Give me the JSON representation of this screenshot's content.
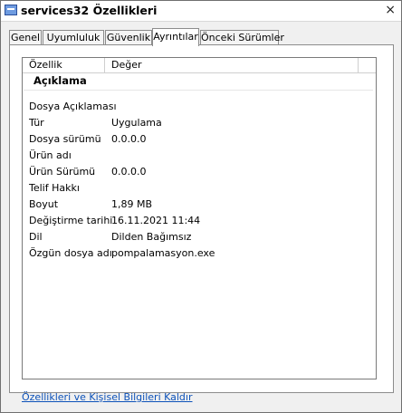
{
  "window": {
    "title": "services32 Özellikleri",
    "close_glyph": "×",
    "icon": "window-icon"
  },
  "tabs": [
    {
      "label": "Genel",
      "active": false
    },
    {
      "label": "Uyumluluk",
      "active": false
    },
    {
      "label": "Güvenlik",
      "active": false
    },
    {
      "label": "Ayrıntılar",
      "active": true
    },
    {
      "label": "Önceki Sürümler",
      "active": false
    }
  ],
  "details": {
    "columns": {
      "property": "Özellik",
      "value": "Değer"
    },
    "section": "Açıklama",
    "rows": [
      {
        "key": "Dosya Açıklaması",
        "value": ""
      },
      {
        "key": "Tür",
        "value": "Uygulama"
      },
      {
        "key": "Dosya sürümü",
        "value": "0.0.0.0"
      },
      {
        "key": "Ürün adı",
        "value": ""
      },
      {
        "key": "Ürün Sürümü",
        "value": "0.0.0.0"
      },
      {
        "key": "Telif Hakkı",
        "value": ""
      },
      {
        "key": "Boyut",
        "value": "1,89 MB"
      },
      {
        "key": "Değiştirme tarihi",
        "value": "16.11.2021 11:44"
      },
      {
        "key": "Dil",
        "value": "Dilden Bağımsız"
      },
      {
        "key": "Özgün dosya adı",
        "value": "pompalamasyon.exe"
      }
    ]
  },
  "footer": {
    "remove_link": "Özellikleri ve Kişisel Bilgileri Kaldır"
  }
}
